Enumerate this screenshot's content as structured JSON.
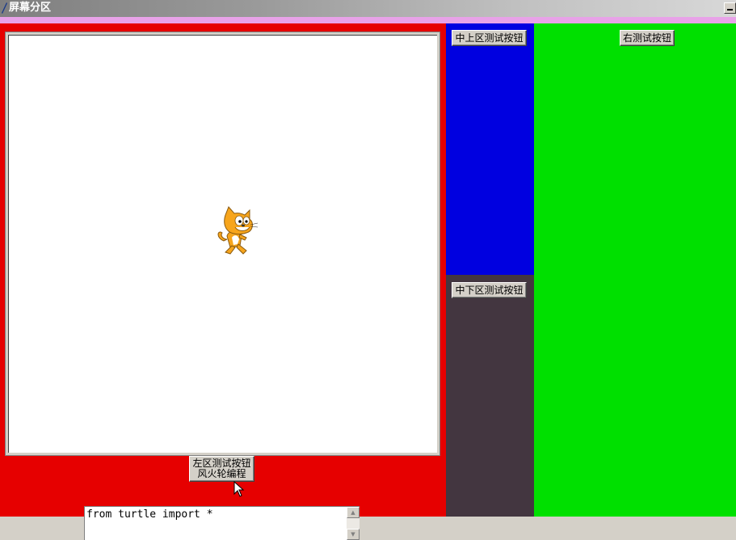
{
  "window": {
    "title": "屏幕分区"
  },
  "colors": {
    "left_frame": "#e60000",
    "mid_top_frame": "#0000e0",
    "mid_bottom_frame": "#433640",
    "right_frame": "#00e000",
    "menu_strip": "#e8a2e8"
  },
  "left": {
    "button_line1": "左区测试按钮",
    "button_line2": "风火轮编程",
    "editor_text": "from turtle import *",
    "sprite": "scratch-cat-icon"
  },
  "middle": {
    "top_button": "中上区测试按钮",
    "bottom_button": "中下区测试按钮"
  },
  "right": {
    "button": "右测试按钮"
  }
}
